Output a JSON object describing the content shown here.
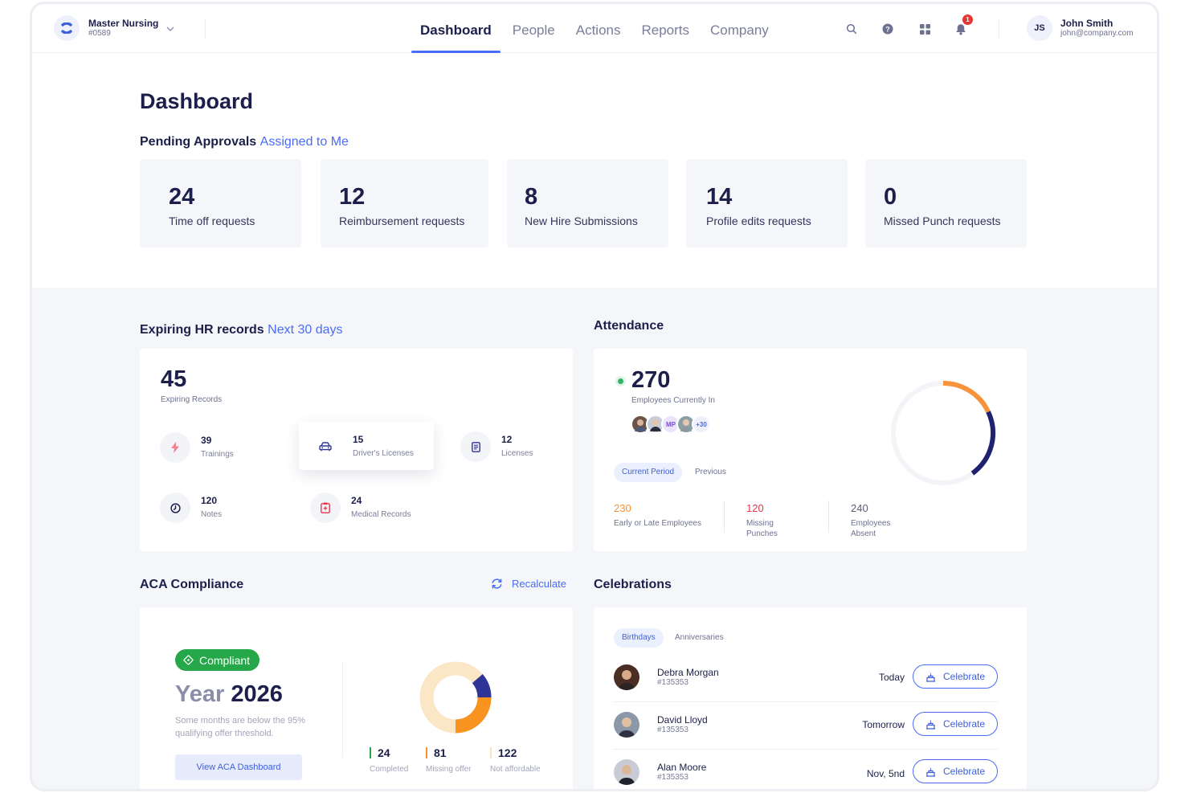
{
  "org": {
    "name": "Master Nursing",
    "id": "#0589"
  },
  "nav": [
    "Dashboard",
    "People",
    "Actions",
    "Reports",
    "Company"
  ],
  "notifications": {
    "count": "1"
  },
  "user": {
    "initials": "JS",
    "name": "John Smith",
    "email": "john@company.com"
  },
  "page": {
    "title": "Dashboard"
  },
  "pending": {
    "title": "Pending Approvals",
    "accent": "Assigned to Me",
    "cards": [
      {
        "value": "24",
        "label": "Time off requests"
      },
      {
        "value": "12",
        "label": "Reimbursement requests"
      },
      {
        "value": "8",
        "label": "New Hire Submissions"
      },
      {
        "value": "14",
        "label": "Profile edits requests"
      },
      {
        "value": "0",
        "label": "Missed Punch requests"
      }
    ]
  },
  "hr": {
    "title": "Expiring HR records",
    "accent": "Next 30 days",
    "total": "45",
    "total_label": "Expiring Records",
    "items": [
      {
        "value": "39",
        "label": "Trainings",
        "icon": "bolt-icon"
      },
      {
        "value": "15",
        "label": "Driver's Licenses",
        "icon": "car-icon"
      },
      {
        "value": "12",
        "label": "Licenses",
        "icon": "document-icon"
      },
      {
        "value": "120",
        "label": "Notes",
        "icon": "clock-icon"
      },
      {
        "value": "24",
        "label": "Medical Records",
        "icon": "medical-clipboard-icon"
      }
    ]
  },
  "attendance": {
    "title": "Attendance",
    "count": "270",
    "count_label": "Employees Currently In",
    "avatar_initials": "MP",
    "avatar_more": "+30",
    "tabs": [
      "Current Period",
      "Previous"
    ],
    "ring_fraction": 0.4,
    "stats": [
      {
        "value": "230",
        "label": "Early or Late Employees",
        "color": "#f7933a"
      },
      {
        "value": "120",
        "label": "Missing Punches",
        "color": "#e5394e"
      },
      {
        "value": "240",
        "label": "Employees Absent",
        "color": "#5b5f7d"
      }
    ]
  },
  "aca": {
    "title": "ACA Compliance",
    "recalculate": "Recalculate",
    "badge": "Compliant",
    "year_prefix": "Year",
    "year": "2026",
    "note": "Some months are below the 95% qualifying offer threshold.",
    "button": "View ACA Dashboard",
    "stats": [
      {
        "value": "24",
        "label": "Completed",
        "color": "#26a84a"
      },
      {
        "value": "81",
        "label": "Missing offer",
        "color": "#f7931e"
      },
      {
        "value": "122",
        "label": "Not affordable",
        "color": "#fbe8c8"
      }
    ],
    "donut_colors": {
      "completed": "#2f3597",
      "missing": "#f7931e",
      "not_affordable": "#fbe6c5"
    }
  },
  "celebrations": {
    "title": "Celebrations",
    "tabs": [
      "Birthdays",
      "Anniversaries"
    ],
    "button": "Celebrate",
    "rows": [
      {
        "name": "Debra Morgan",
        "id": "#135353",
        "when": "Today"
      },
      {
        "name": "David Lloyd",
        "id": "#135353",
        "when": "Tomorrow"
      },
      {
        "name": "Alan Moore",
        "id": "#135353",
        "when": "Nov, 5nd"
      }
    ]
  },
  "colors": {
    "accent": "#4a6cf7",
    "navy": "#1c1f4a",
    "bg_grey": "#f5f6fa"
  }
}
